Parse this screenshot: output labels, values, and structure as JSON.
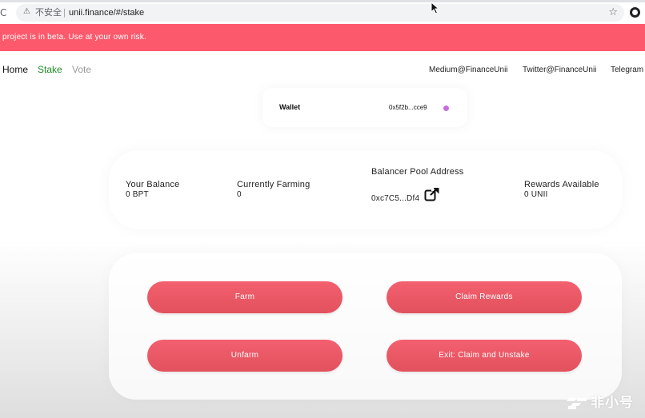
{
  "browser": {
    "security_label": "不安全",
    "separator": "|",
    "url": "unii.finance/#/stake",
    "icons": [
      "reload-icon",
      "warning-icon",
      "star-icon",
      "profile-icon",
      "cursor-icon"
    ]
  },
  "banner": {
    "text": "project is in beta. Use at your own risk.",
    "color": "#fc5a6c"
  },
  "nav": {
    "home": "Home",
    "stake": "Stake",
    "vote": "Vote",
    "active_color": "#1f8a24",
    "external": {
      "medium": "Medium@FinanceUnii",
      "twitter": "Twitter@FinanceUnii",
      "telegram": "Telegram"
    }
  },
  "wallet": {
    "label": "Wallet",
    "address": "0x5f2b...cce9",
    "status_color": "#c86ddf"
  },
  "stats": {
    "balance": {
      "label": "Your Balance",
      "value": "0 BPT"
    },
    "farming": {
      "label": "Currently Farming",
      "value": "0"
    },
    "pool": {
      "label": "Balancer Pool Address",
      "value": "0xc7C5...Df4",
      "icon": "open-link-icon"
    },
    "rewards": {
      "label": "Rewards Available",
      "value": "0 UNII"
    }
  },
  "actions": {
    "farm": "Farm",
    "claim": "Claim Rewards",
    "unfarm": "Unfarm",
    "exit": "Exit: Claim and Unstake",
    "button_color": "#f05a69"
  },
  "watermark": {
    "text": "非小号"
  }
}
